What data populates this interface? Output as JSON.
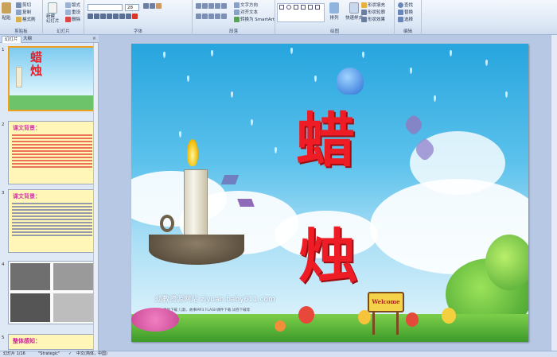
{
  "ribbon": {
    "clipboard": {
      "paste": "粘贴",
      "cut": "剪切",
      "copy": "复制",
      "format_painter": "格式刷",
      "label": "剪贴板"
    },
    "slides": {
      "new_slide": "新建\n幻灯片",
      "layout": "版式",
      "reset": "重设",
      "delete": "删除",
      "label": "幻灯片"
    },
    "font": {
      "size": "28",
      "label": "字体"
    },
    "paragraph": {
      "text_direction": "文字方向",
      "align_text": "对齐文本",
      "smartart": "转换为 SmartArt",
      "label": "段落"
    },
    "drawing": {
      "arrange": "排列",
      "quick_styles": "快速样式",
      "shape_fill": "形状填充",
      "shape_outline": "形状轮廓",
      "shape_effects": "形状效果",
      "label": "绘图"
    },
    "editing": {
      "find": "查找",
      "replace": "替换",
      "select": "选择",
      "label": "编辑"
    }
  },
  "panel": {
    "tabs": [
      "幻灯片",
      "大纲"
    ],
    "close": "×",
    "slides": [
      {
        "number": "1",
        "title": "蜡烛"
      },
      {
        "number": "2",
        "title": "课文背景："
      },
      {
        "number": "3",
        "title": "课文背景："
      },
      {
        "number": "4"
      },
      {
        "number": "5",
        "title": "整体感知："
      }
    ]
  },
  "slide": {
    "title_char_1": "蜡",
    "title_char_2": "烛",
    "welcome_sign": "Welcome",
    "watermark": "幼教资源网站  ziyuan.baby611.com",
    "watermark_sub": "课件下载    儿歌、故事MP3    FLASH课件下载    试卷下载等"
  },
  "status": {
    "slide_info": "幻灯片 1/16",
    "theme": "\"Strategic\"",
    "language": "中文(简体，中国)"
  },
  "colors": {
    "title_red": "#ee1c25",
    "sky_blue": "#27a5de",
    "selected_thumb_border": "#f0a020"
  }
}
